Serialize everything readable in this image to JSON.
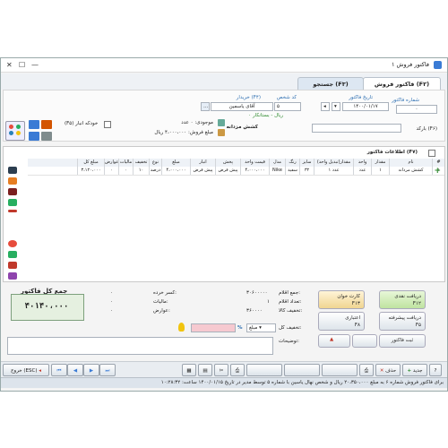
{
  "window": {
    "title": "فاکتور فروش ۱"
  },
  "tabs": [
    {
      "label": "فاکتور فروش (F۲)"
    },
    {
      "label": "جستجو (F۳)"
    }
  ],
  "header": {
    "invoice_no_label": "شماره فاکتور",
    "invoice_no_value": "۰",
    "invoice_date_label": "تاریخ فاکتور",
    "invoice_date_value": "۱۴۰۰/۰۱/۱۷",
    "code_label": "کد شخص",
    "code_value": "۵",
    "buyer_label": "خریدار (F۴)",
    "buyer_value": "آقای یاسمین",
    "balance_text": "۰ ریال - بستانکار",
    "barcode_label": "بارکد (F۶)",
    "product_label": "کشش مزدانه",
    "stock_text": "موجودی: ۰ عدد",
    "sale_price_text": "مبلغ فروش: ۴،۰۰۰،۰۰۰ ریال",
    "warehouse_label": "(F۵) خودکه انبار"
  },
  "grid": {
    "items_title": "اطلاعات فاکتور (F۷)",
    "columns": [
      "#",
      "نام",
      "مقدار",
      "واحد",
      "مقدار(تبدیل واحد)",
      "سایز",
      "رنگ",
      "مدل",
      "قیمت واحد",
      "پخش",
      "انبار",
      "مبلغ",
      "نوع",
      "تخفیف",
      "مالیات",
      "عوارض",
      "مبلغ کل"
    ],
    "rows": [
      [
        "۱",
        "کشش مردانه",
        "۱",
        "عدد",
        "۱ عدد",
        "۳۲",
        "سفید",
        "Nike",
        "۴،۰۰۰،۰۰۰",
        "پیش فرض",
        "پیش فرض",
        "۴،۰۰۰،۰۰۰",
        "درصد",
        "۱۰",
        "۰",
        "۰",
        "۳،۱۲۰،۰۰۰"
      ]
    ]
  },
  "summary": {
    "total_title": "جمع کل فاکتور",
    "total_value": "۴۰۱۴۰،۰۰۰",
    "sum_items_label": "جمع اقلام:",
    "sum_items_value": "۳۰۶۰۰۰۰۰",
    "count_items_label": "تعداد اقلام:",
    "count_items_value": "۱",
    "discount_goods_label": "تخفیف کالا:",
    "discount_goods_value": "۳۶۰۰۰۰",
    "deductions_label": "کسر خرده:",
    "deductions_value": "۰",
    "tax_label": "مالیات:",
    "tax_value": "۰",
    "duties_label": "عوارض:",
    "duties_value": "۰",
    "total_discount_label": "تخفیف کل:",
    "discount_type_value": "مبلغ",
    "percent_sign": "%",
    "description_label": "توضیحات:"
  },
  "payments": {
    "cash_label": "دریافت نقدی",
    "cash_key": "F۱۲",
    "card_label": "کارت خوان",
    "card_key": "F۱۳",
    "prepay_label": "دریافت پیشرفته",
    "prepay_key": "F۵",
    "credit_label": "اعتباری",
    "credit_key": "F۸",
    "register_label": "ثبت فاکتور"
  },
  "toolbar": {
    "new_label": "جدید",
    "delete_label": "حذف",
    "cancel_label": "انصراف",
    "exit_label": "خروج (ESC)"
  },
  "status_bar": {
    "text": "برای فاکتور فروش شماره ۶ به مبلغ ۲۰،۳۵۰،۰۰۰ ریال و شخص نهال یاسین با شماره ۵ توسط مدیر در تاریخ ۱۴۰۰/۰۱/۱۵ ساعت: ۱۰:۲۸:۳۲"
  },
  "colors": {
    "accent_green": "#2e8b2e",
    "tab_active": "#ffffff",
    "status_bg": "#dde4ec"
  }
}
